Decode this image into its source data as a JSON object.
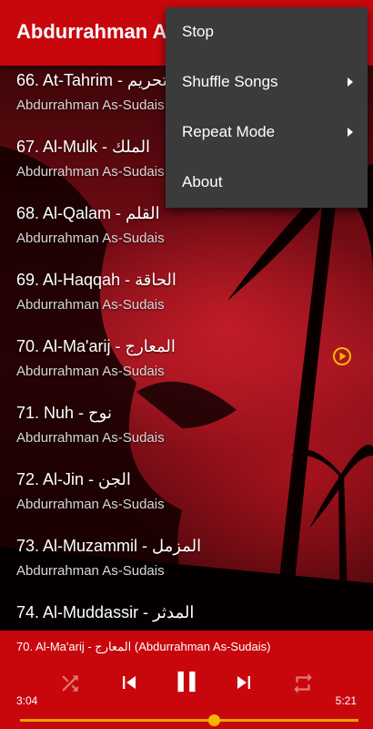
{
  "app_bar": {
    "title": "Abdurrahman As-Sudais"
  },
  "songs": [
    {
      "title": "66. At-Tahrim - التحريم",
      "artist": "Abdurrahman As-Sudais"
    },
    {
      "title": "67. Al-Mulk - الملك",
      "artist": "Abdurrahman As-Sudais"
    },
    {
      "title": "68. Al-Qalam - القلم",
      "artist": "Abdurrahman As-Sudais"
    },
    {
      "title": "69. Al-Haqqah - الحاقة",
      "artist": "Abdurrahman As-Sudais"
    },
    {
      "title": "70. Al-Ma'arij - المعارج",
      "artist": "Abdurrahman As-Sudais",
      "playing": true
    },
    {
      "title": "71. Nuh - نوح",
      "artist": "Abdurrahman As-Sudais"
    },
    {
      "title": "72. Al-Jin - الجن",
      "artist": "Abdurrahman As-Sudais"
    },
    {
      "title": "73. Al-Muzammil - المزمل",
      "artist": "Abdurrahman As-Sudais"
    },
    {
      "title": "74. Al-Muddassir - المدثر",
      "artist": ""
    }
  ],
  "menu": {
    "items": [
      {
        "label": "Stop",
        "submenu": false
      },
      {
        "label": "Shuffle Songs",
        "submenu": true
      },
      {
        "label": "Repeat Mode",
        "submenu": true
      },
      {
        "label": "About",
        "submenu": false
      }
    ]
  },
  "player": {
    "now_playing": "70. Al-Ma'arij - المعارج (Abdurrahman As-Sudais)",
    "elapsed": "3:04",
    "duration": "5:21",
    "progress": 0.573,
    "shuffle_enabled": false,
    "repeat_enabled": false,
    "icons": [
      "shuffle-icon",
      "skip-previous-icon",
      "pause-icon",
      "skip-next-icon",
      "repeat-icon"
    ]
  },
  "colors": {
    "primary": "#c8070d",
    "menu_bg": "#3b3b3b",
    "accent": "#f5b800",
    "disabled_icon": "#e07a7a"
  }
}
